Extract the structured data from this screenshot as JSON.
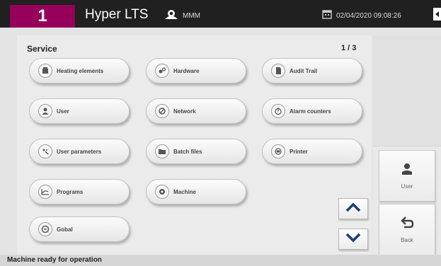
{
  "header": {
    "number": "1",
    "title": "Hyper LTS",
    "user": "MMM",
    "datetime": "02/04/2020 09:08:26"
  },
  "panel": {
    "title": "Service",
    "page": "1 / 3",
    "buttons": [
      {
        "label": "Heating elements",
        "icon": "heater-icon"
      },
      {
        "label": "Hardware",
        "icon": "hardware-icon"
      },
      {
        "label": "Audit Trail",
        "icon": "document-icon"
      },
      {
        "label": "User",
        "icon": "user-icon"
      },
      {
        "label": "Network",
        "icon": "network-icon"
      },
      {
        "label": "Alarm counters",
        "icon": "alarm-counter-icon"
      },
      {
        "label": "User parameters",
        "icon": "user-parameters-icon"
      },
      {
        "label": "Batch files",
        "icon": "batch-files-icon"
      },
      {
        "label": "Printer",
        "icon": "printer-icon"
      },
      {
        "label": "Programs",
        "icon": "programs-icon"
      },
      {
        "label": "Machine",
        "icon": "machine-icon"
      },
      {
        "label": "Gobal",
        "icon": "globe-icon"
      }
    ]
  },
  "side": {
    "user_label": "User",
    "back_label": "Back"
  },
  "status": {
    "text": "Machine ready for operation"
  },
  "colors": {
    "brand": "#97005a",
    "header_bg": "#202020",
    "accent_blue": "#1a3b78"
  }
}
